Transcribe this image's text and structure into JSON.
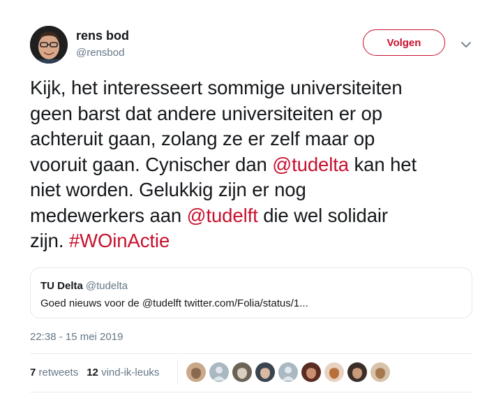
{
  "tweet": {
    "author": {
      "name": "rens bod",
      "handle": "@rensbod"
    },
    "follow_label": "Volgen",
    "text_lines": [
      [
        {
          "t": "Kijk, het interesseert sommige universiteiten"
        }
      ],
      [
        {
          "t": "geen barst dat andere universiteiten er op"
        }
      ],
      [
        {
          "t": "achteruit gaan, zolang ze er zelf maar op"
        }
      ],
      [
        {
          "t": "vooruit gaan. Cynischer dan "
        },
        {
          "t": "@tudelta",
          "k": "mention"
        },
        {
          "t": " kan het"
        }
      ],
      [
        {
          "t": "niet worden. Gelukkig zijn er nog"
        }
      ],
      [
        {
          "t": "medewerkers aan "
        },
        {
          "t": "@tudelft",
          "k": "mention"
        },
        {
          "t": " die wel solidair"
        }
      ],
      [
        {
          "t": "zijn. "
        },
        {
          "t": "#WOinActie",
          "k": "hashtag"
        }
      ]
    ],
    "quote": {
      "name": "TU Delta",
      "handle": "@tudelta",
      "text": "Goed nieuws voor de @tudelft twitter.com/Folia/status/1..."
    },
    "timestamp": "22:38 - 15 mei 2019",
    "stats": {
      "retweets_count": "7",
      "retweets_label": "retweets",
      "likes_count": "12",
      "likes_label": "vind-ik-leuks"
    },
    "liker_avatars": [
      {
        "icon": "avatar-woman-blonde",
        "bg": "#c9a98a",
        "fg": "#8a6a4e"
      },
      {
        "icon": "avatar-default",
        "bg": "#aab8c2",
        "fg": "#e1e8ed"
      },
      {
        "icon": "avatar-group-photo",
        "bg": "#6b6356",
        "fg": "#d8cfc0"
      },
      {
        "icon": "avatar-man-glasses",
        "bg": "#3a4450",
        "fg": "#d9b9a0"
      },
      {
        "icon": "avatar-default",
        "bg": "#aab8c2",
        "fg": "#e1e8ed"
      },
      {
        "icon": "avatar-man-dark-hair",
        "bg": "#5a2d22",
        "fg": "#c98f70"
      },
      {
        "icon": "avatar-woman-red-hair",
        "bg": "#e8d2c2",
        "fg": "#b8703a"
      },
      {
        "icon": "avatar-man-beard",
        "bg": "#3b2e28",
        "fg": "#c99a7c"
      },
      {
        "icon": "avatar-woman-light",
        "bg": "#d7c3ab",
        "fg": "#a77850"
      }
    ],
    "colors": {
      "accent": "#c8102e",
      "secondary_text": "#657786",
      "border": "#e1e8ed"
    }
  }
}
